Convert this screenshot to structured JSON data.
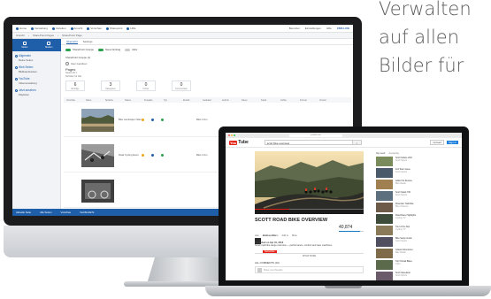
{
  "tagline": {
    "line1": "Verwalten",
    "line2": "auf allen",
    "line3": "Bilder für"
  },
  "imac_app": {
    "topbar": {
      "items": [
        "Home",
        "Verwaltung",
        "Verteilen",
        "Ansicht",
        "Vorschau",
        "Sharepoint",
        "Hilfe"
      ],
      "right": [
        "Benutzer",
        "Einstellungen",
        "Hilfe",
        "CMS LIVE"
      ]
    },
    "breadcrumbs": [
      "Ansicht",
      "SharePoint Pages",
      "SharePoint Page"
    ],
    "sidebar": {
      "head_buttons": [
        "Seiten",
        "Medien"
      ],
      "sections": [
        {
          "title": "Allgemein",
          "sub": "Meine Seiten"
        },
        {
          "title": "Web Seiten",
          "sub": "Bilddatenbanken"
        },
        {
          "title": "YouTube",
          "sub": "Videoverwaltung"
        },
        {
          "title": "Jetzt ansehen",
          "sub": "Playlisten"
        }
      ]
    },
    "main": {
      "tabs": [
        "Übersicht",
        "Settings"
      ],
      "share_items": [
        "SharePoint Gruppe",
        "Neuer Eintrag",
        "Aktiv"
      ],
      "share_row2": "SharePoint Gruppe (1)",
      "add_user": "User zuordnen",
      "pages_title": "Pages",
      "pages_meta": [
        "Seiten-ID 1",
        "Sichtbar für Alle"
      ],
      "stats": [
        {
          "n": "6",
          "l": "Einträge"
        },
        {
          "n": "3",
          "l": "Kategorien"
        },
        {
          "n": "0",
          "l": "Fehler"
        },
        {
          "n": "0",
          "l": "Kommentare"
        }
      ],
      "columns": [
        "Vorschau",
        "Name",
        "Sprache",
        "Status",
        "Freigabe",
        "Typ",
        "Erstellt",
        "Geändert",
        "Aufrufe",
        "Dauer",
        "Kanal",
        "Größe",
        "Format",
        "Version"
      ],
      "rows": [
        {
          "title": "Bike Landscape Video",
          "end": "Bike 4 Fun"
        },
        {
          "title": "Road Cycling Event",
          "end": "Bike 4 Fun"
        }
      ]
    },
    "footer": [
      "Aktuelle Seite",
      "Alle Seiten",
      "Vorschau",
      "Veröffentlicht"
    ]
  },
  "youtube": {
    "url": "youtube.com",
    "logo_you": "You",
    "logo_tube": "Tube",
    "search_query": "scott bike overview",
    "upload_label": "Upload",
    "signin_label": "Sign in",
    "video_title": "SCOTT ROAD BIKE OVERVIEW",
    "channel_name": "scott-sports",
    "subscribe_label": "Subscribe",
    "views": "40,874",
    "likes_fraction": 0.86,
    "progress_fraction": 0.32,
    "actions": [
      "Like",
      "About",
      "Share",
      "Add to",
      "More"
    ],
    "desc_line1": "Published on Apr 10, 2013",
    "desc_line2": "Scott road bike range overview — performance, comfort and race machines.",
    "show_more": "SHOW MORE",
    "comments_heading": "ALL COMMENTS (10)",
    "comment_placeholder": "Share your thoughts",
    "side_heading": "Up next",
    "side_autoplay": "Autoplay",
    "suggestions": [
      {
        "title": "Scott Solace 2014",
        "meta": "Scott Sports"
      },
      {
        "title": "Foil Team Issue",
        "meta": "Scott Sports"
      },
      {
        "title": "Addict SL Review",
        "meta": "Bike Radar"
      },
      {
        "title": "Scott Spark 700",
        "meta": "Scott Sports"
      },
      {
        "title": "Mountain Trail Ride",
        "meta": "Bike Channel"
      },
      {
        "title": "Road Race Highlights",
        "meta": "Cycling TV"
      },
      {
        "title": "Tour of the Alps",
        "meta": "Cycling TV"
      },
      {
        "title": "Bike Setup Guide",
        "meta": "Scott Sports"
      },
      {
        "title": "Gravel Adventures",
        "meta": "Bike Radar"
      },
      {
        "title": "Top 5 Road Bikes",
        "meta": "GCN"
      },
      {
        "title": "Scott Speedster",
        "meta": "Scott Sports"
      }
    ]
  },
  "colors": {
    "brand_blue": "#1f5ea8",
    "youtube_red": "#e62117"
  }
}
